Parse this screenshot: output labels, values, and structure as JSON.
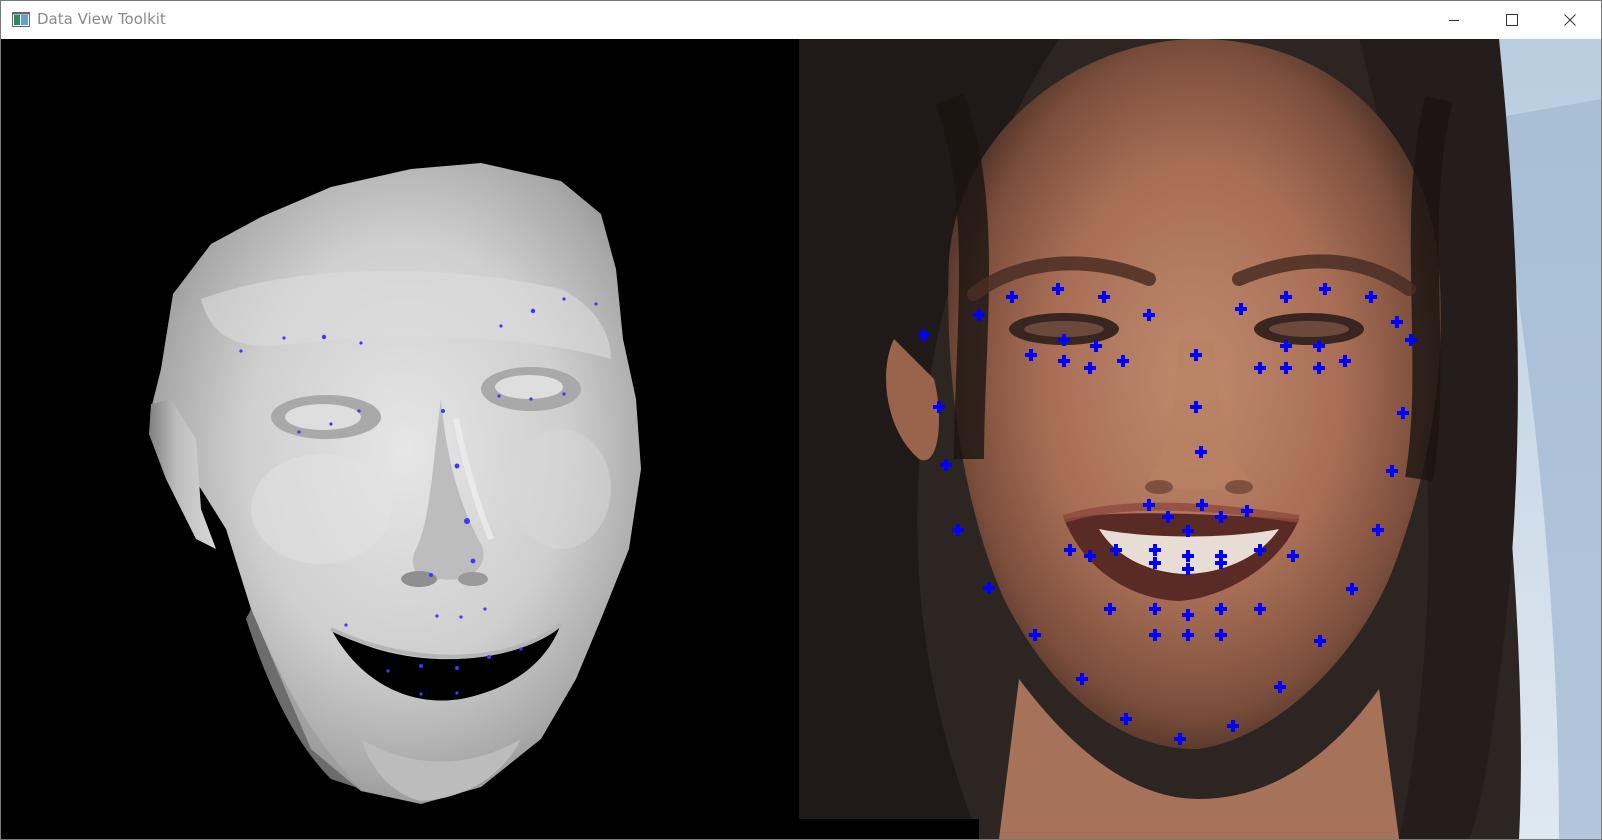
{
  "window": {
    "title": "Data View Toolkit",
    "icon": "app-icon",
    "controls": {
      "minimize_icon": "minimize-icon",
      "maximize_icon": "maximize-icon",
      "close_icon": "close-icon"
    }
  },
  "views": {
    "left": {
      "kind": "3d-face-mesh-render",
      "background": "#000000",
      "mesh_color": "#d4d4d4",
      "landmark_color": "#3a3aff"
    },
    "right": {
      "kind": "photo-with-landmarks",
      "marker_color": "#0000ff",
      "marker_shape": "plus"
    }
  }
}
